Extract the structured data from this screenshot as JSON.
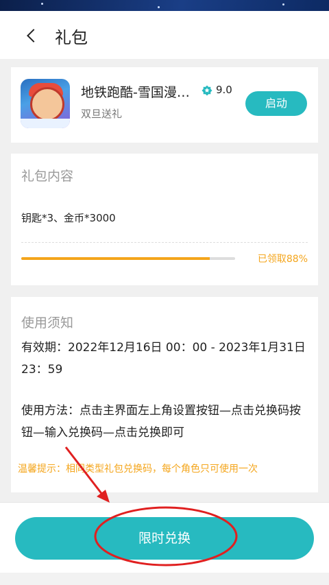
{
  "header": {
    "title": "礼包"
  },
  "game": {
    "name": "地铁跑酷-雪国漫…",
    "rating": "9.0",
    "subtitle": "双旦送礼",
    "launch_label": "启动"
  },
  "gift": {
    "section_title": "礼包内容",
    "contents": "钥匙*3、金币*3000",
    "claimed_percent": 88,
    "claimed_label": "已领取88%"
  },
  "usage": {
    "section_title": "使用须知",
    "validity": "有效期：2022年12月16日 00：00 - 2023年1月31日 23：59",
    "method": "使用方法：点击主界面左上角设置按钮—点击兑换码按钮—输入兑换码—点击兑换即可",
    "tip": "温馨提示：相同类型礼包兑换码，每个角色只可使用一次"
  },
  "action": {
    "redeem_label": "限时兑换"
  },
  "colors": {
    "accent": "#27bac0",
    "orange": "#f4a51b",
    "annotation_red": "#e02020"
  },
  "icons": [
    "back-icon",
    "rating-badge-icon",
    "game-icon"
  ]
}
